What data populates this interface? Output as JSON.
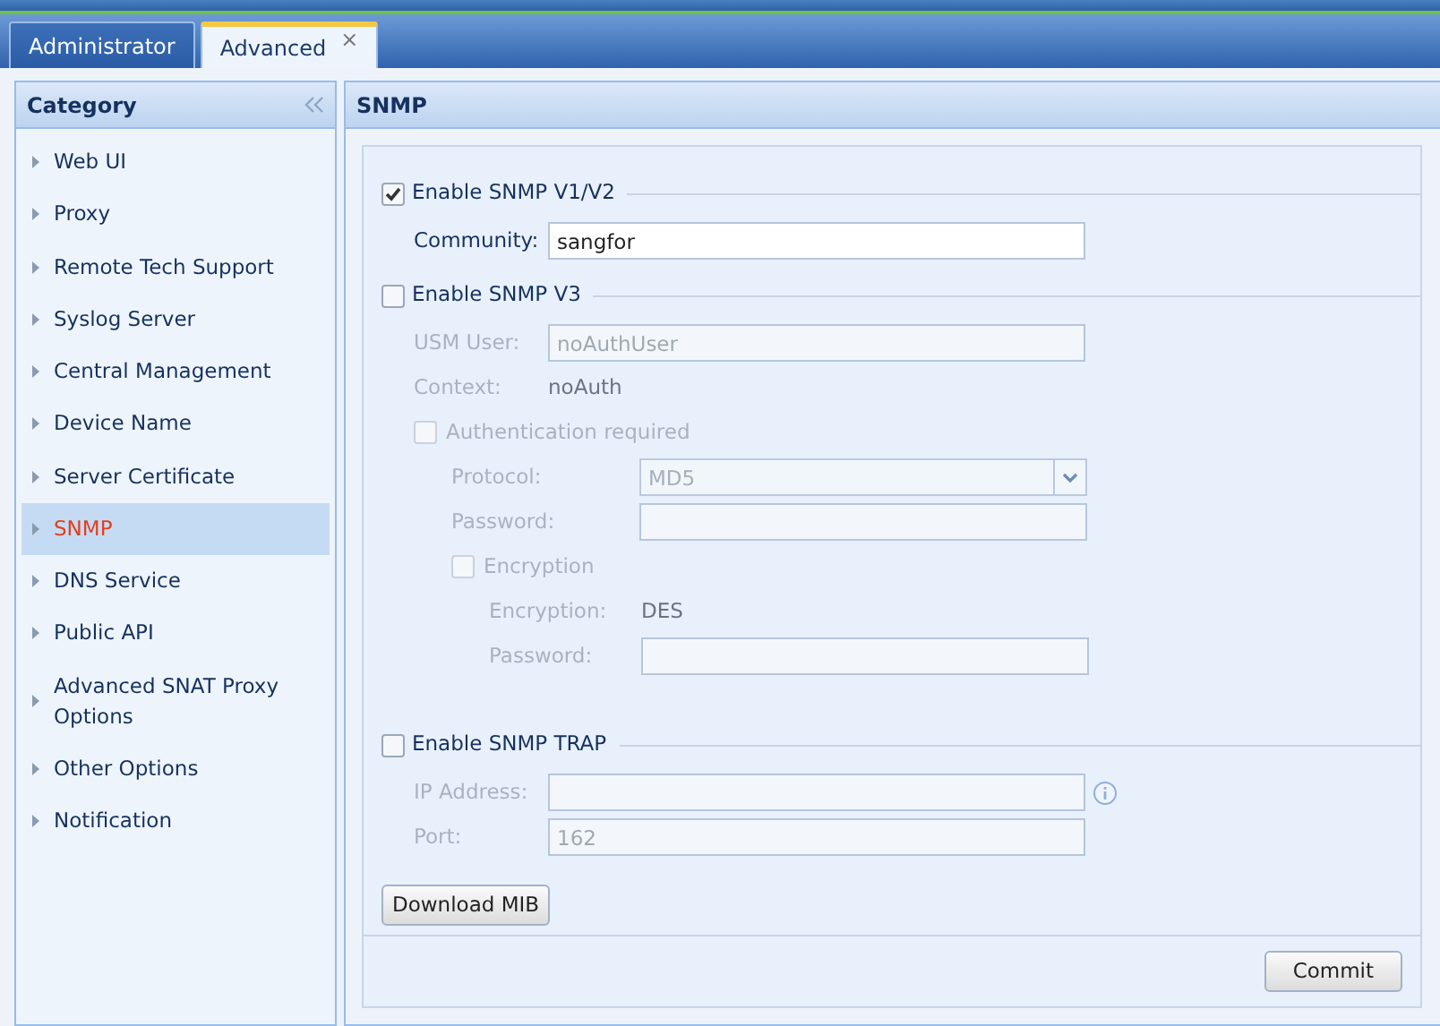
{
  "tabs": [
    {
      "label": "Administrator",
      "selected": false
    },
    {
      "label": "Advanced",
      "selected": true,
      "close": "×"
    }
  ],
  "sidebar": {
    "title": "Category",
    "items": [
      {
        "label": "Web UI",
        "selected": false
      },
      {
        "label": "Proxy",
        "selected": false
      },
      {
        "label": "Remote Tech Support",
        "selected": false
      },
      {
        "label": "Syslog Server",
        "selected": false
      },
      {
        "label": "Central Management",
        "selected": false
      },
      {
        "label": "Device Name",
        "selected": false
      },
      {
        "label": "Server Certificate",
        "selected": false
      },
      {
        "label": "SNMP",
        "selected": true
      },
      {
        "label": "DNS Service",
        "selected": false
      },
      {
        "label": "Public API",
        "selected": false
      },
      {
        "label": "Advanced SNAT Proxy Options",
        "selected": false
      },
      {
        "label": "Other Options",
        "selected": false
      },
      {
        "label": "Notification",
        "selected": false
      }
    ]
  },
  "panel": {
    "title": "SNMP",
    "sections": [
      {
        "label": "Enable SNMP V1/V2",
        "checked": true,
        "rows": [
          {
            "kind": "input",
            "label": "Community:",
            "value": "sangfor",
            "disabled": false
          }
        ]
      },
      {
        "label": "Enable SNMP V3",
        "checked": false,
        "rows": [
          {
            "kind": "input",
            "label": "USM User:",
            "value": "noAuthUser",
            "disabled": true
          },
          {
            "kind": "text",
            "label": "Context:",
            "value": "noAuth",
            "disabled": true
          },
          {
            "kind": "checkbox",
            "label": "Authentication required",
            "checked": false,
            "disabled": true,
            "children": [
              {
                "kind": "select",
                "label": "Protocol:",
                "value": "MD5",
                "disabled": true
              },
              {
                "kind": "input",
                "label": "Password:",
                "disabled": true
              },
              {
                "kind": "checkbox",
                "label": "Encryption",
                "checked": false,
                "disabled": true,
                "children": [
                  {
                    "kind": "text",
                    "label": "Encryption:",
                    "value": "DES",
                    "disabled": true
                  },
                  {
                    "kind": "input",
                    "label": "Password:",
                    "disabled": true
                  }
                ]
              }
            ]
          }
        ]
      },
      {
        "label": "Enable SNMP TRAP",
        "checked": false,
        "rows": [
          {
            "kind": "input",
            "label": "IP Address:",
            "disabled": true,
            "info": true
          },
          {
            "kind": "input",
            "label": "Port:",
            "value": "162",
            "disabled": true
          }
        ]
      }
    ],
    "buttons": [
      {
        "label": "Download MIB"
      }
    ],
    "footer_buttons": [
      {
        "label": "Commit"
      }
    ]
  }
}
